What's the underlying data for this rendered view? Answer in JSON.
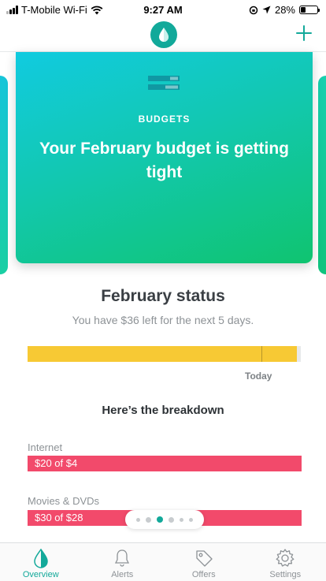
{
  "status_bar": {
    "carrier": "T-Mobile Wi-Fi",
    "time": "9:27 AM",
    "battery": "28%",
    "battery_level": 0.28
  },
  "nav": {
    "logo_icon": "drop-logo-icon",
    "add_icon": "plus-icon"
  },
  "hero": {
    "icon": "budget-bars-icon",
    "eyebrow": "BUDGETS",
    "title": "Your February budget is getting tight"
  },
  "status": {
    "title": "February status",
    "subtitle": "You have $36 left for the next 5 days.",
    "spent_fraction": 0.985,
    "today_fraction": 0.856,
    "today_label": "Today"
  },
  "breakdown": {
    "title": "Here’s the breakdown",
    "categories": [
      {
        "name": "Internet",
        "amount": "$20 of $4"
      },
      {
        "name": "Movies & DVDs",
        "amount": "$30 of $28"
      }
    ]
  },
  "pager": {
    "count": 6,
    "active_index": 2
  },
  "tabs": [
    {
      "label": "Overview",
      "icon": "drop-icon",
      "active": true
    },
    {
      "label": "Alerts",
      "icon": "bell-icon",
      "active": false
    },
    {
      "label": "Offers",
      "icon": "tag-icon",
      "active": false
    },
    {
      "label": "Settings",
      "icon": "gear-icon",
      "active": false
    }
  ],
  "colors": {
    "accent": "#13a99a",
    "budget_bar": "#f7c934",
    "over_budget": "#f24a6b"
  }
}
